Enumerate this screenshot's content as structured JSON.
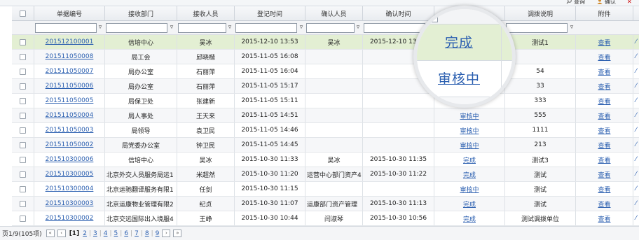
{
  "toolbar": {
    "query_label": "查询",
    "confirm_label": "确认",
    "close_label": "✕"
  },
  "columns": {
    "doc_no": "单据编号",
    "dept": "接收部门",
    "receiver": "接收人员",
    "reg_time": "登记时间",
    "confirmer": "确认人员",
    "confirm_time": "确认时间",
    "status": "",
    "note": "调拨说明",
    "attachment": "附件"
  },
  "filter": {
    "icon": "▿",
    "values": [
      "",
      "",
      "",
      "",
      "",
      "",
      "",
      ""
    ]
  },
  "rows": [
    {
      "doc_no": "201512100001",
      "dept": "信培中心",
      "receiver": "吴冰",
      "reg_time": "2015-12-10 13:53",
      "confirmer": "吴冰",
      "confirm_time": "2015-12-10 13:59",
      "status": "完成",
      "note": "测试1",
      "attachment": "查看",
      "highlight": true
    },
    {
      "doc_no": "201511050008",
      "dept": "局工会",
      "receiver": "邱晓楷",
      "reg_time": "2015-11-05 16:08",
      "confirmer": "",
      "confirm_time": "",
      "status": "审核中",
      "note": "",
      "attachment": "查看"
    },
    {
      "doc_no": "201511050007",
      "dept": "局办公室",
      "receiver": "石丽萍",
      "reg_time": "2015-11-05 16:04",
      "confirmer": "",
      "confirm_time": "",
      "status": "审核中",
      "note": "54",
      "attachment": "查看"
    },
    {
      "doc_no": "201511050006",
      "dept": "局办公室",
      "receiver": "石丽萍",
      "reg_time": "2015-11-05 15:17",
      "confirmer": "",
      "confirm_time": "",
      "status": "审核中",
      "note": "33",
      "attachment": "查看"
    },
    {
      "doc_no": "201511050005",
      "dept": "局保卫处",
      "receiver": "张建新",
      "reg_time": "2015-11-05 15:11",
      "confirmer": "",
      "confirm_time": "",
      "status": "审核中",
      "note": "333",
      "attachment": "查看"
    },
    {
      "doc_no": "201511050004",
      "dept": "局人事处",
      "receiver": "王天来",
      "reg_time": "2015-11-05 14:51",
      "confirmer": "",
      "confirm_time": "",
      "status": "审核中",
      "note": "555",
      "attachment": "查看"
    },
    {
      "doc_no": "201511050003",
      "dept": "局领导",
      "receiver": "袁卫民",
      "reg_time": "2015-11-05 14:46",
      "confirmer": "",
      "confirm_time": "",
      "status": "审核中",
      "note": "1111",
      "attachment": "查看"
    },
    {
      "doc_no": "201511050002",
      "dept": "局党委办公室",
      "receiver": "钟卫民",
      "reg_time": "2015-11-05 14:45",
      "confirmer": "",
      "confirm_time": "",
      "status": "审核中",
      "note": "213",
      "attachment": "查看"
    },
    {
      "doc_no": "201510300006",
      "dept": "信培中心",
      "receiver": "吴冰",
      "reg_time": "2015-10-30 11:33",
      "confirmer": "吴冰",
      "confirm_time": "2015-10-30 11:35",
      "status": "完成",
      "note": "测试3",
      "attachment": "查看"
    },
    {
      "doc_no": "201510300005",
      "dept": "北京外交人员服务局运1",
      "receiver": "米超然",
      "reg_time": "2015-10-30 11:20",
      "confirmer": "运营中心部门资产4",
      "confirm_time": "2015-10-30 11:22",
      "status": "完成",
      "note": "测试",
      "attachment": "查看"
    },
    {
      "doc_no": "201510300004",
      "dept": "北京运驰翻译服务有限1",
      "receiver": "任剑",
      "reg_time": "2015-10-30 11:15",
      "confirmer": "",
      "confirm_time": "",
      "status": "审核中",
      "note": "测试",
      "attachment": "查看"
    },
    {
      "doc_no": "201510300003",
      "dept": "北京运康物业管理有限2",
      "receiver": "纪贞",
      "reg_time": "2015-10-30 11:07",
      "confirmer": "运康部门资产管理",
      "confirm_time": "2015-10-30 11:13",
      "status": "完成",
      "note": "测试",
      "attachment": "查看"
    },
    {
      "doc_no": "201510300002",
      "dept": "北京交远国际出入境服4",
      "receiver": "王峥",
      "reg_time": "2015-10-30 10:44",
      "confirmer": "闫淑琴",
      "confirm_time": "2015-10-30 10:56",
      "status": "完成",
      "note": "测试调拨单位",
      "attachment": "查看"
    }
  ],
  "op_char": "⁄",
  "magnifier": {
    "line1": "完成",
    "line2": "审核中"
  },
  "pager": {
    "summary": "页1/9(105项)",
    "first": "«",
    "prev": "‹",
    "current": "[1]",
    "pages": [
      "2",
      "3",
      "4",
      "5",
      "6",
      "7",
      "8",
      "9"
    ],
    "next": "›",
    "last": "»"
  },
  "colors": {
    "link": "#2b5fb0",
    "highlight_row": "#e3efd3"
  }
}
